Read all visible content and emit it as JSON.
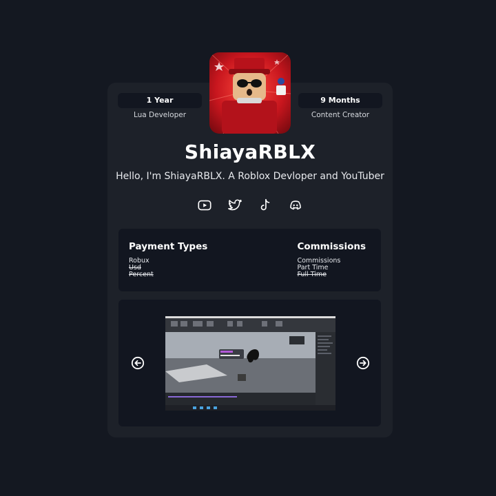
{
  "profile": {
    "username": "ShiayaRBLX",
    "bio": "Hello, I'm ShiayaRBLX. A Roblox Devloper and YouTuber"
  },
  "stats": [
    {
      "value": "1 Year",
      "label": "Lua Developer"
    },
    {
      "value": "9 Months",
      "label": "Content Creator"
    }
  ],
  "socials": [
    {
      "icon": "youtube-icon"
    },
    {
      "icon": "twitter-icon"
    },
    {
      "icon": "tiktok-icon"
    },
    {
      "icon": "discord-icon"
    }
  ],
  "payment": {
    "title": "Payment Types",
    "items": [
      {
        "label": "Robux",
        "struck": false
      },
      {
        "label": "Usd",
        "struck": true
      },
      {
        "label": "Percent",
        "struck": true
      }
    ]
  },
  "commissions": {
    "title": "Commissions",
    "items": [
      {
        "label": "Commissions",
        "struck": false
      },
      {
        "label": "Part Time",
        "struck": false
      },
      {
        "label": "Full Time",
        "struck": true
      }
    ]
  },
  "gallery": {
    "prev_icon": "arrow-left-circle-icon",
    "next_icon": "arrow-right-circle-icon"
  },
  "colors": {
    "background": "#141821",
    "card": "#1d2129",
    "panel": "#121620",
    "accent_red": "#c8161e"
  }
}
